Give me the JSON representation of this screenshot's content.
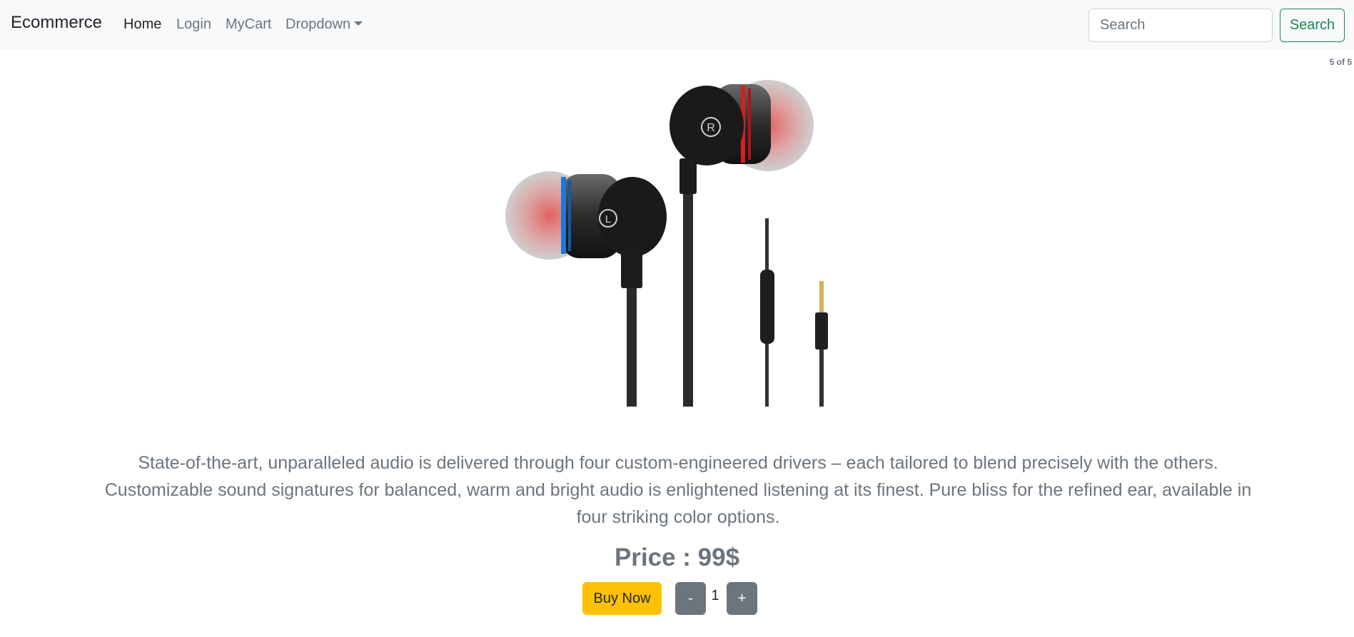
{
  "navbar": {
    "brand": "Ecommerce",
    "links": [
      {
        "label": "Home",
        "active": true
      },
      {
        "label": "Login",
        "active": false
      },
      {
        "label": "MyCart",
        "active": false
      }
    ],
    "dropdown_label": "Dropdown",
    "search": {
      "placeholder": "Search",
      "value": "",
      "button_label": "Search"
    }
  },
  "carousel": {
    "counter": "5 of 5",
    "image_subject": "in-ear earphones with 3.5mm jack",
    "slide_count": 5,
    "active_index": 4
  },
  "product": {
    "description": "State-of-the-art, unparalleled audio is delivered through four custom-engineered drivers – each tailored to blend precisely with the others. Customizable sound signatures for balanced, warm and bright audio is enlightened listening at its finest. Pure bliss for the refined ear, available in four striking color options.",
    "price": "Price : 99$"
  },
  "actions": {
    "buy_now_label": "Buy Now",
    "decrement_label": "-",
    "quantity": "1",
    "increment_label": "+"
  },
  "colors": {
    "navbar_bg": "#f8f9fa",
    "search_button": "#198754",
    "buy_button": "#ffc107",
    "quantity_buttons": "#6c757d"
  }
}
